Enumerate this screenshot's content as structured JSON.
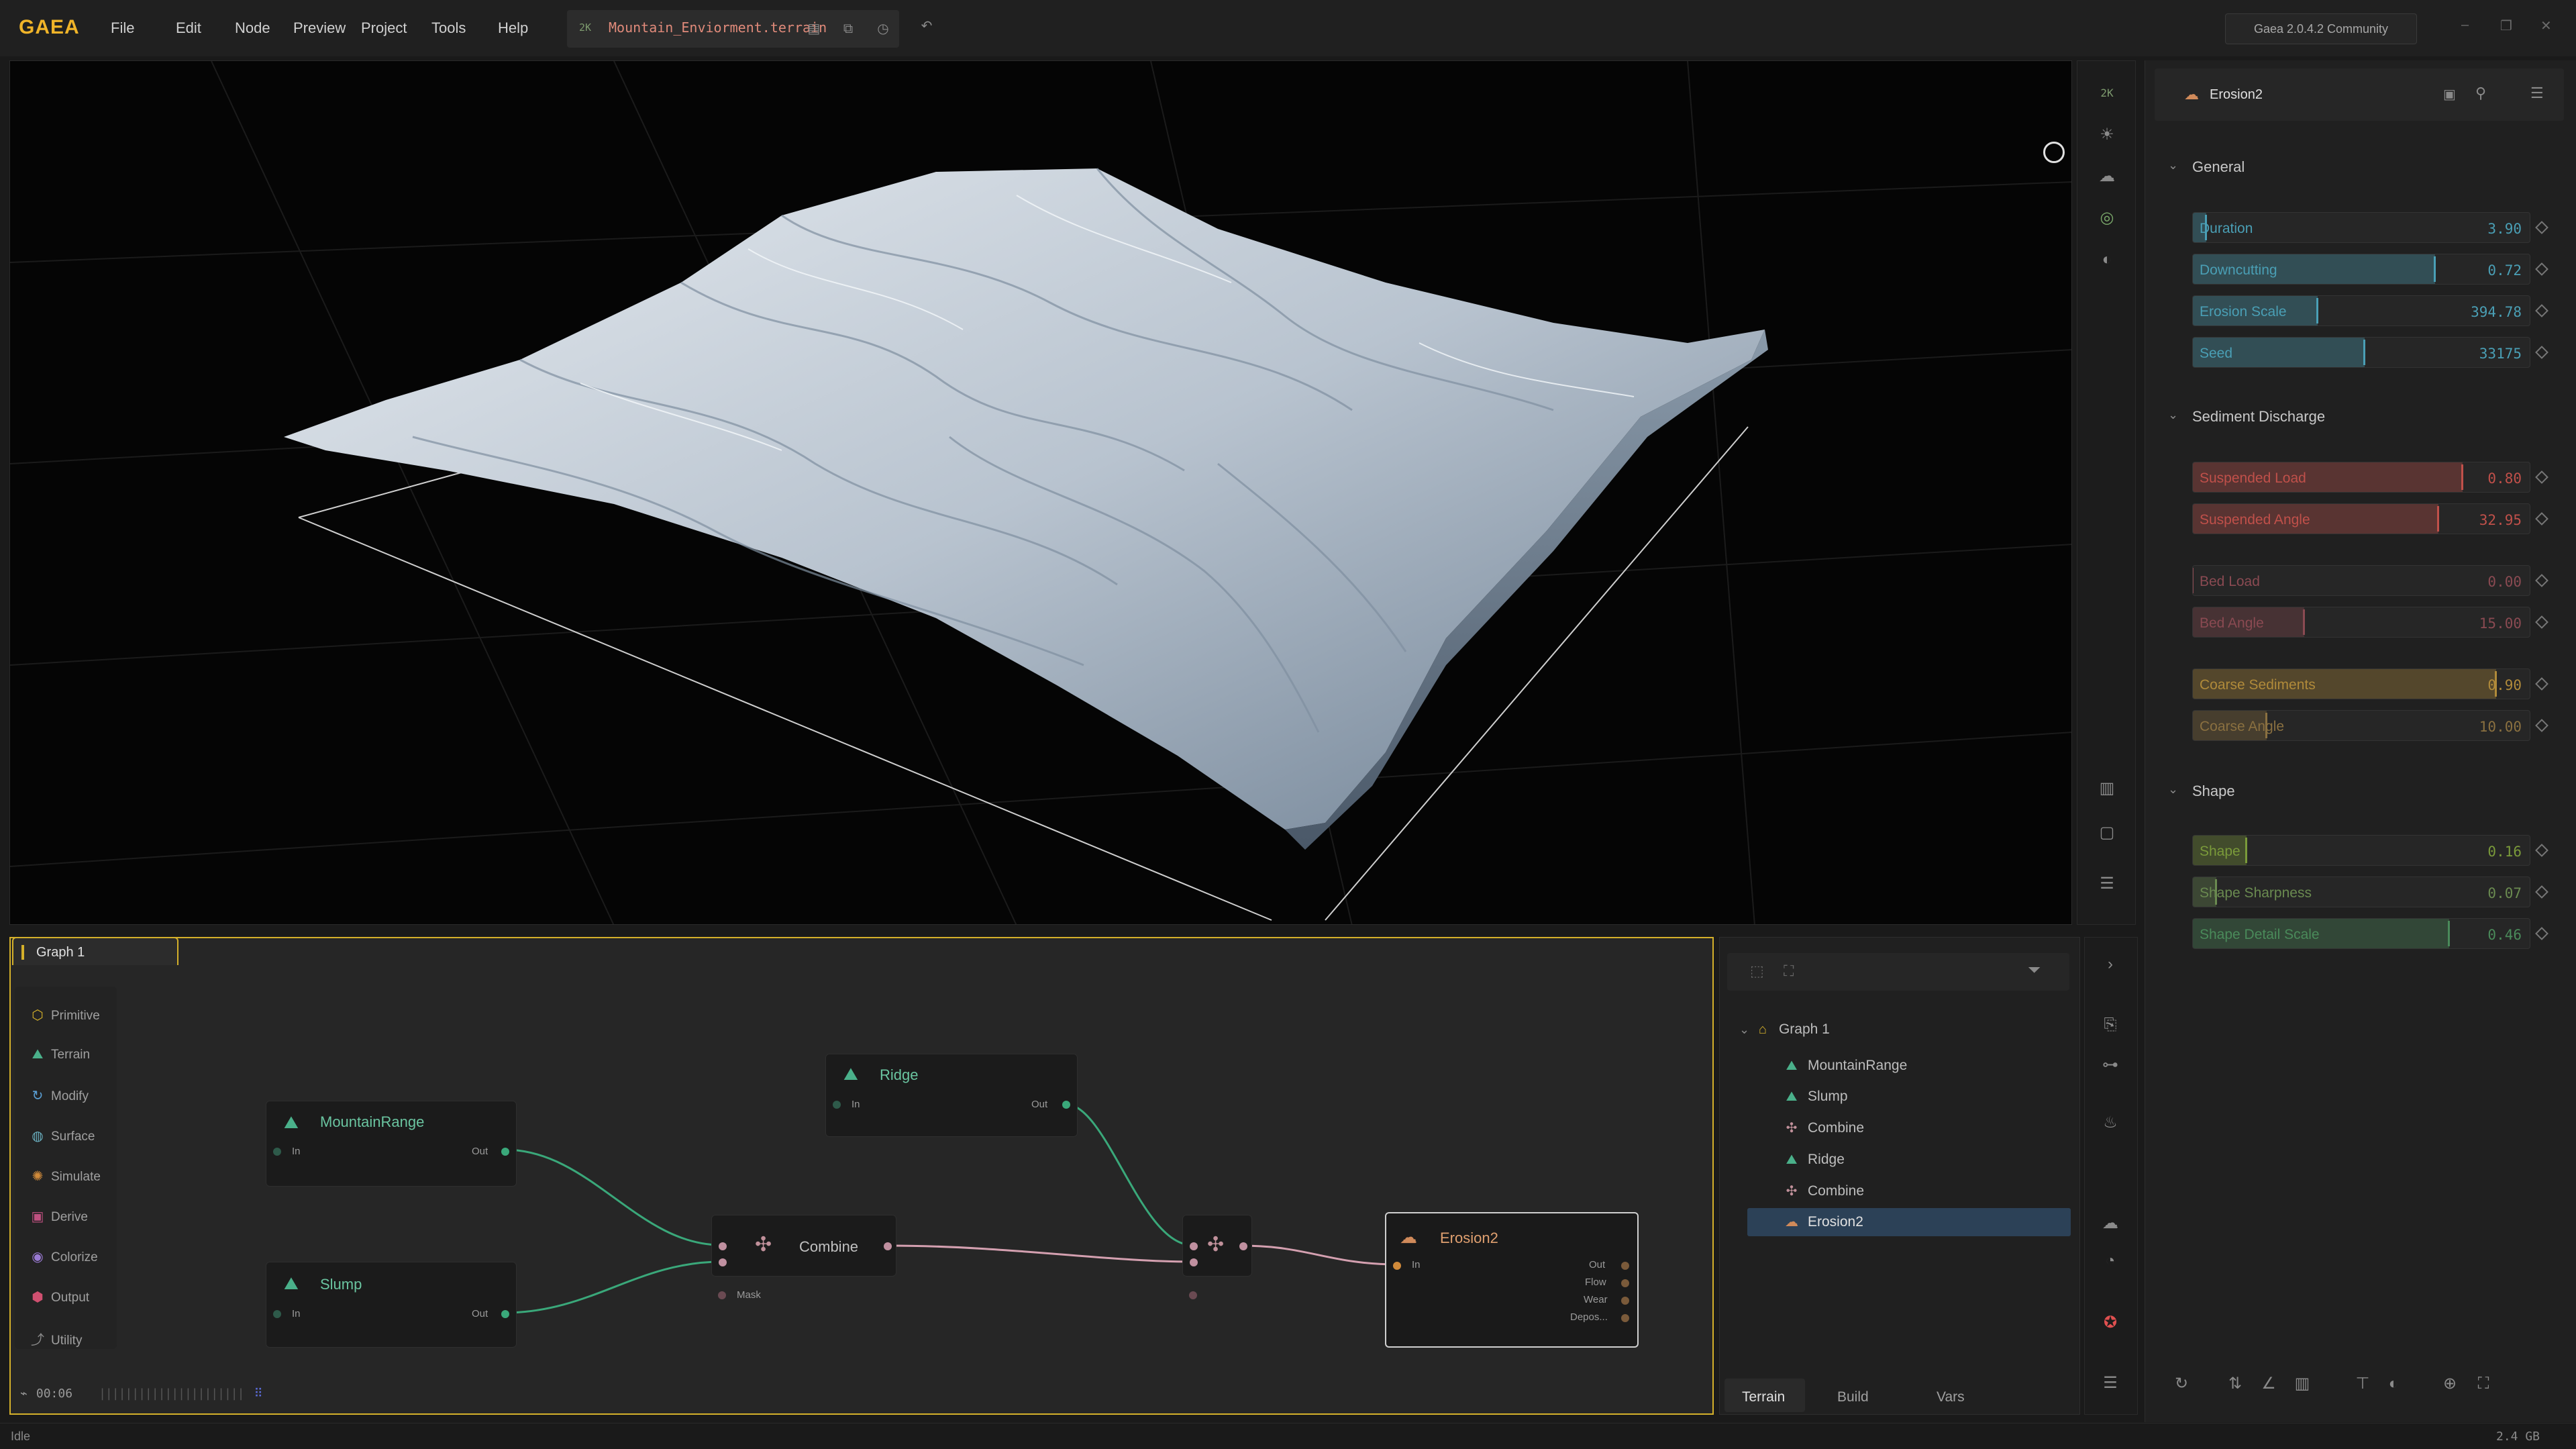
{
  "app": {
    "logo": "GAEA",
    "version": "Gaea 2.0.4.2 Community"
  },
  "menu": [
    "File",
    "Edit",
    "Node",
    "Preview",
    "Project",
    "Tools",
    "Help"
  ],
  "file_tab": {
    "resolution": "2K",
    "filename": "Mountain_Enviorment.terrain"
  },
  "viewport": {
    "resolution_badge": "2K"
  },
  "properties": {
    "node_name": "Erosion2",
    "sections": [
      {
        "title": "General"
      },
      {
        "title": "Sediment Discharge"
      },
      {
        "title": "Shape"
      }
    ],
    "sliders": [
      {
        "label": "Duration",
        "value": "3.90",
        "fraction": 0.04,
        "color": "#4a9fb5"
      },
      {
        "label": "Downcutting",
        "value": "0.72",
        "fraction": 0.72,
        "color": "#4a9fb5"
      },
      {
        "label": "Erosion Scale",
        "value": "394.78",
        "fraction": 0.37,
        "color": "#4a9fb5"
      },
      {
        "label": "Seed",
        "value": "33175",
        "fraction": 0.51,
        "color": "#4a9fb5"
      },
      {
        "label": "Suspended Load",
        "value": "0.80",
        "fraction": 0.8,
        "color": "#c0504a"
      },
      {
        "label": "Suspended Angle",
        "value": "32.95",
        "fraction": 0.73,
        "color": "#c0504a"
      },
      {
        "label": "Bed Load",
        "value": "0.00",
        "fraction": 0.0,
        "color": "#8a4a52"
      },
      {
        "label": "Bed Angle",
        "value": "15.00",
        "fraction": 0.33,
        "color": "#8a4a52"
      },
      {
        "label": "Coarse Sediments",
        "value": "0.90",
        "fraction": 0.9,
        "color": "#b08a3a"
      },
      {
        "label": "Coarse Angle",
        "value": "10.00",
        "fraction": 0.22,
        "color": "#8a7040"
      },
      {
        "label": "Shape",
        "value": "0.16",
        "fraction": 0.16,
        "color": "#7a9a3a"
      },
      {
        "label": "Shape Sharpness",
        "value": "0.07",
        "fraction": 0.07,
        "color": "#6a8a50"
      },
      {
        "label": "Shape Detail Scale",
        "value": "0.46",
        "fraction": 0.76,
        "color": "#4a8a5a"
      }
    ]
  },
  "graph": {
    "tab_label": "Graph 1",
    "palette": [
      "Primitive",
      "Terrain",
      "Modify",
      "Surface",
      "Simulate",
      "Derive",
      "Colorize",
      "Output",
      "Utility"
    ],
    "status_time": "00:06",
    "nodes": {
      "mountain": {
        "title": "MountainRange",
        "in": "In",
        "out": "Out"
      },
      "slump": {
        "title": "Slump",
        "in": "In",
        "out": "Out"
      },
      "ridge": {
        "title": "Ridge",
        "in": "In",
        "out": "Out"
      },
      "combine": {
        "title": "Combine",
        "mask": "Mask"
      },
      "erosion": {
        "title": "Erosion2",
        "in": "In",
        "outs": [
          "Out",
          "Flow",
          "Wear",
          "Depos..."
        ]
      }
    }
  },
  "tree": {
    "root": "Graph 1",
    "items": [
      "MountainRange",
      "Slump",
      "Combine",
      "Ridge",
      "Combine",
      "Erosion2"
    ],
    "tabs": [
      "Terrain",
      "Build",
      "Vars"
    ]
  },
  "status": {
    "text": "Idle",
    "memory": "2.4 GB"
  }
}
